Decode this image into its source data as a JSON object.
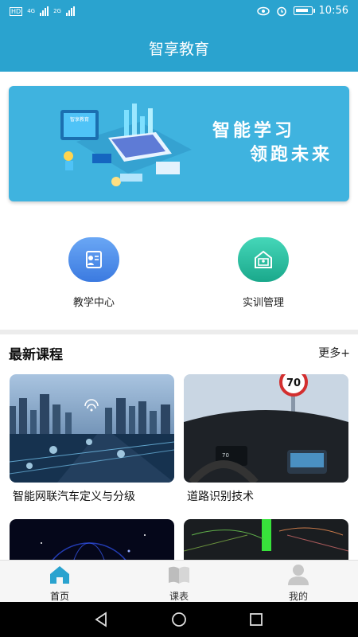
{
  "status_bar": {
    "left_badge": "HD",
    "network_1": "4G",
    "network_2": "2G",
    "time": "10:56"
  },
  "header": {
    "title": "智享教育"
  },
  "banner": {
    "line1": "智能学习",
    "line2": "领跑未来",
    "screen_caption": "智享教育"
  },
  "quick_actions": [
    {
      "label": "教学中心",
      "icon": "teaching-center-icon"
    },
    {
      "label": "实训管理",
      "icon": "training-management-icon"
    }
  ],
  "courses_section": {
    "title": "最新课程",
    "more_label": "更多+",
    "items": [
      {
        "title": "智能网联汽车定义与分级"
      },
      {
        "title": "道路识别技术",
        "sign_text": "70"
      },
      {
        "title": ""
      },
      {
        "title": ""
      }
    ]
  },
  "tabbar": {
    "items": [
      {
        "label": "首页",
        "icon": "home-icon",
        "active": true
      },
      {
        "label": "课表",
        "icon": "book-icon",
        "active": false
      },
      {
        "label": "我的",
        "icon": "user-icon",
        "active": false
      }
    ]
  },
  "colors": {
    "primary": "#2aa3cf",
    "banner": "#3fb3df",
    "tab_active": "#2aa3cf"
  }
}
